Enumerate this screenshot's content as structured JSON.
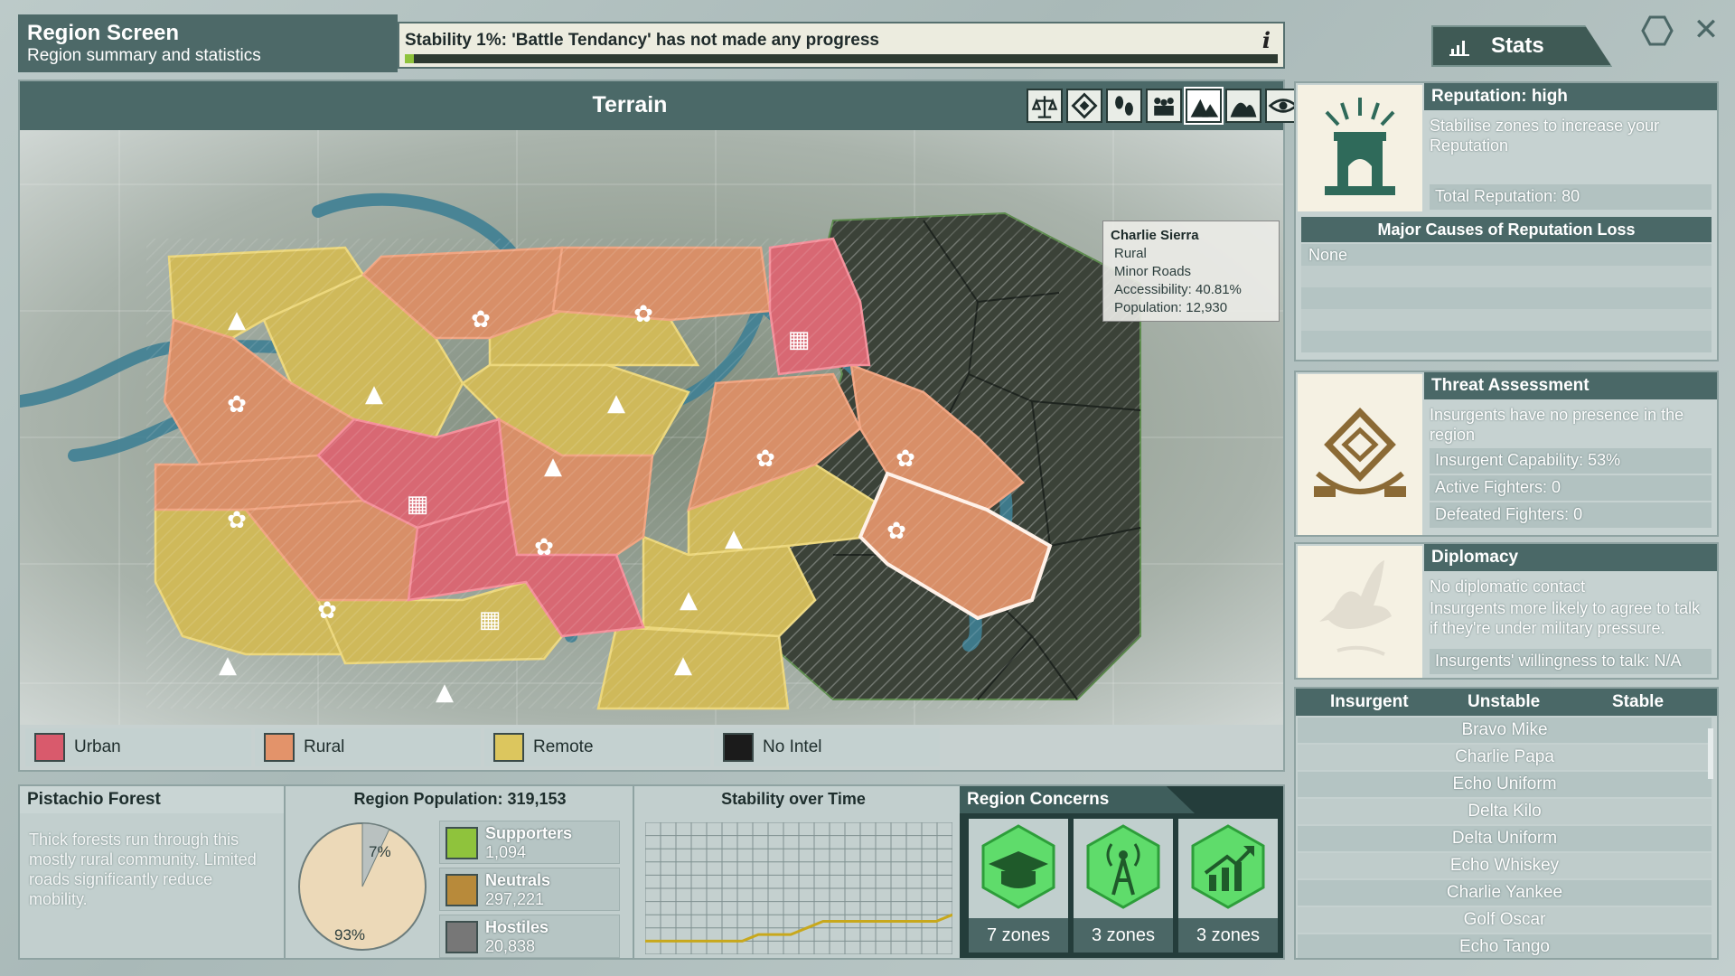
{
  "header": {
    "title": "Region Screen",
    "subtitle": "Region summary and statistics",
    "stability_message": "Stability 1%: 'Battle Tendancy' has not made any progress",
    "stability_progress": 0.01,
    "info_icon": "i",
    "stats_label": "Stats"
  },
  "map": {
    "title": "Terrain",
    "filters": [
      {
        "name": "balance-icon",
        "active": false
      },
      {
        "name": "diamond-icon",
        "active": false
      },
      {
        "name": "footprints-icon",
        "active": false
      },
      {
        "name": "people-icon",
        "active": false
      },
      {
        "name": "mountains-icon",
        "active": true
      },
      {
        "name": "hills-icon",
        "active": false
      },
      {
        "name": "eye-icon",
        "active": false
      }
    ],
    "tooltip": {
      "name": "Charlie Sierra",
      "type": "Rural",
      "roads": "Minor Roads",
      "accessibility": "Accessibility: 40.81%",
      "population": "Population: 12,930"
    },
    "legend": [
      {
        "label": "Urban",
        "color": "#d95a6c"
      },
      {
        "label": "Rural",
        "color": "#e3936a"
      },
      {
        "label": "Remote",
        "color": "#dcc65e"
      },
      {
        "label": "No Intel",
        "color": "#1b1b1b"
      }
    ]
  },
  "region": {
    "name": "Pistachio Forest",
    "description": "Thick forests run through this mostly rural community. Limited roads significantly reduce mobility.",
    "population_title": "Region Population: 319,153",
    "pie": {
      "minor_pct": "7%",
      "major_pct": "93%",
      "minor_value": 7,
      "major_value": 93
    },
    "groups": [
      {
        "label": "Supporters",
        "value": "1,094",
        "icon": "supporter-icon",
        "color": "#8fc33c"
      },
      {
        "label": "Neutrals",
        "value": "297,221",
        "icon": "neutral-icon",
        "color": "#b88a3a"
      },
      {
        "label": "Hostiles",
        "value": "20,838",
        "icon": "hostile-icon",
        "color": "#777777"
      }
    ],
    "stability_title": "Stability over Time",
    "stability_series": [
      2,
      2,
      2,
      2,
      2,
      2,
      2,
      3,
      3,
      3,
      4,
      5,
      5,
      5,
      5,
      5,
      5,
      5,
      5,
      6
    ]
  },
  "concerns": {
    "title": "Region Concerns",
    "items": [
      {
        "icon": "education-icon",
        "label": "7 zones"
      },
      {
        "icon": "radio-tower-icon",
        "label": "3 zones"
      },
      {
        "icon": "economy-icon",
        "label": "3 zones"
      }
    ]
  },
  "reputation": {
    "title": "Reputation: high",
    "description": "Stabilise zones to increase your Reputation",
    "total": "Total Reputation: 80",
    "loss_title": "Major Causes of Reputation Loss",
    "loss_items": [
      "None",
      "",
      "",
      "",
      ""
    ]
  },
  "threat": {
    "title": "Threat Assessment",
    "description": "Insurgents have no presence in the region",
    "capability": "Insurgent Capability: 53%",
    "active": "Active Fighters: 0",
    "defeated": "Defeated Fighters: 0"
  },
  "diplomacy": {
    "title": "Diplomacy",
    "line1": "No diplomatic contact",
    "line2": "Insurgents more likely to agree to talk if they're under military pressure.",
    "willingness": "Insurgents' willingness to talk: N/A"
  },
  "insurgent_table": {
    "headers": [
      "Insurgent",
      "Unstable",
      "Stable"
    ],
    "rows": [
      "Bravo Mike",
      "Charlie Papa",
      "Echo Uniform",
      "Delta Kilo",
      "Delta Uniform",
      "Echo Whiskey",
      "Charlie Yankee",
      "Golf Oscar",
      "Echo Tango"
    ]
  }
}
